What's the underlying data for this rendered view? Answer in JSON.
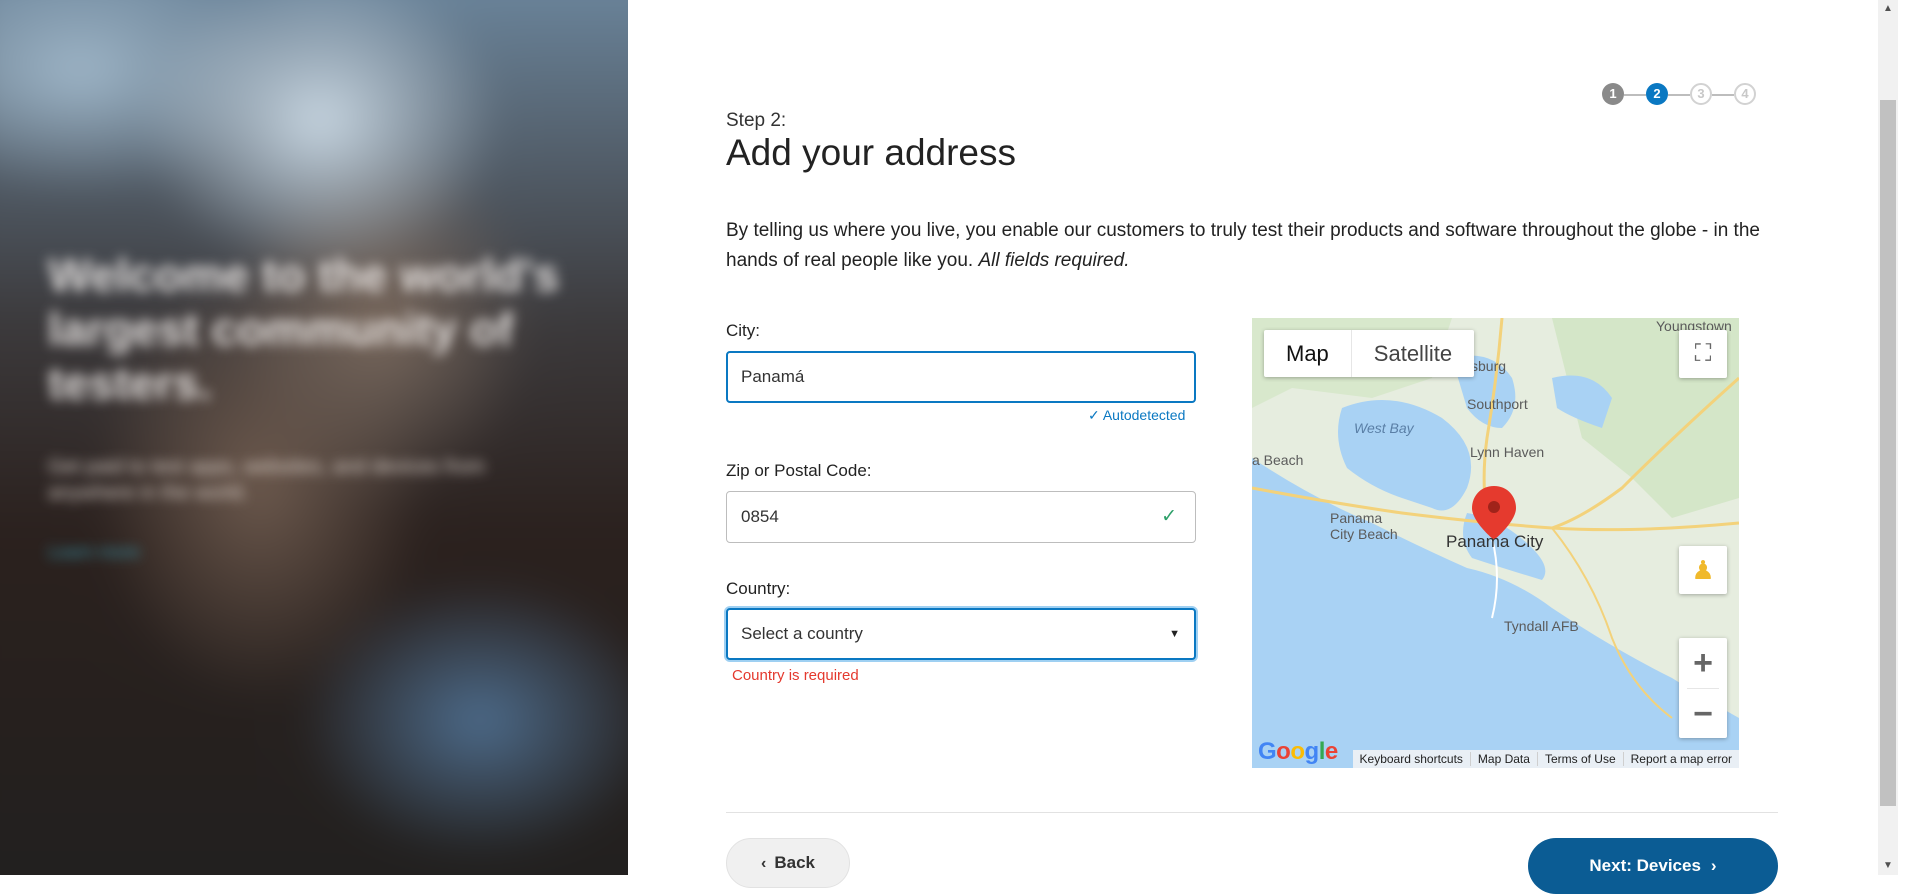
{
  "stepper": {
    "steps": [
      "1",
      "2",
      "3",
      "4"
    ],
    "current": 2
  },
  "header": {
    "step_label": "Step 2:",
    "title": "Add your address",
    "intro": "By telling us where you live, you enable our customers to truly test their products and software throughout the globe - in the hands of real people like you.",
    "intro_emphasis": "All fields required."
  },
  "form": {
    "city_label": "City:",
    "city_value": "Panamá",
    "city_hint": "✓ Autodetected",
    "zip_label": "Zip or Postal Code:",
    "zip_value": "0854",
    "country_label": "Country:",
    "country_placeholder": "Select a country",
    "country_error": "Country is required"
  },
  "map": {
    "type_options": [
      "Map",
      "Satellite"
    ],
    "selected_type": "Map",
    "city_marker": "Panama City",
    "places": [
      "Youngstown",
      "cksburg",
      "Southport",
      "West Bay",
      "Lynn Haven",
      "a Beach",
      "Panama City Beach",
      "Tyndall AFB"
    ],
    "footer_links": [
      "Keyboard shortcuts",
      "Map Data",
      "Terms of Use",
      "Report a map error"
    ],
    "logo": "Google",
    "marker_color": "#e53a2e"
  },
  "hero": {
    "title": "Welcome to the world's largest community of testers.",
    "subtitle": "Get paid to test apps, websites, and devices from anywhere in the world.",
    "link": "Learn more"
  },
  "footer": {
    "back_label": "Back",
    "next_label": "Next: Devices"
  },
  "colors": {
    "primary": "#0a78c2",
    "button": "#0b5c94",
    "error": "#e4392e",
    "success": "#2ea06a"
  }
}
